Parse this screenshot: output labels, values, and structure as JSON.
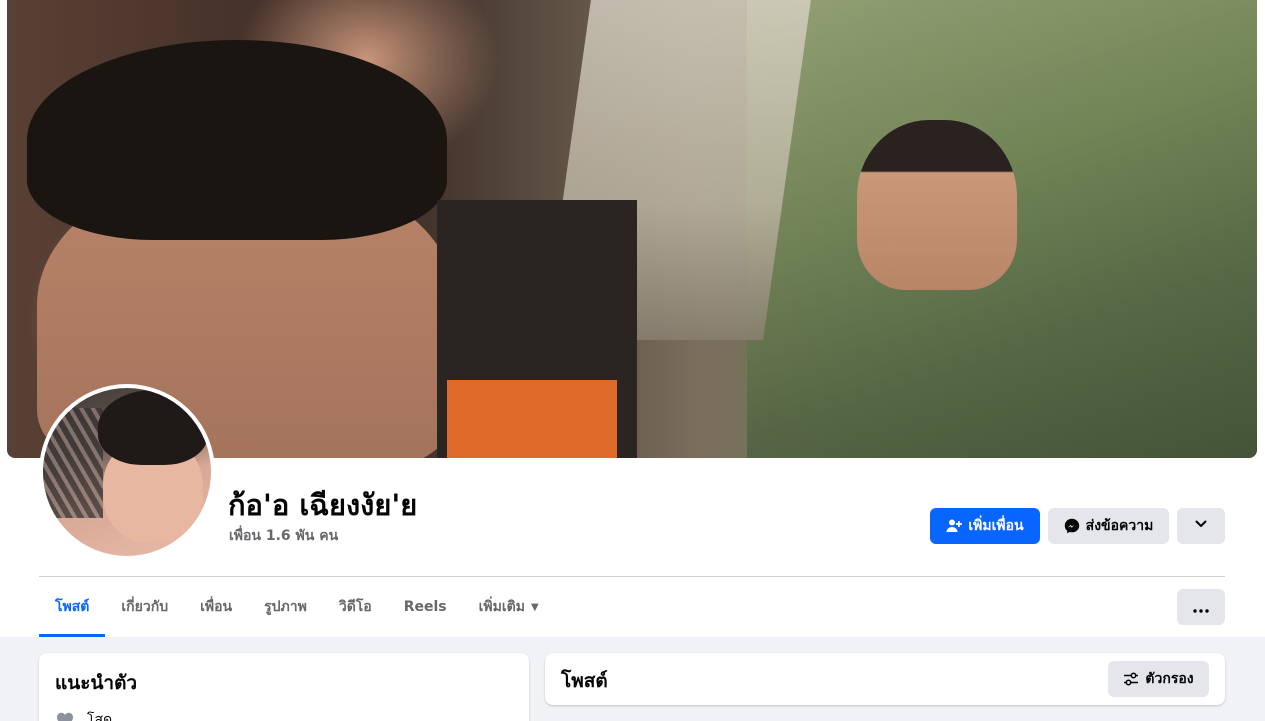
{
  "profile": {
    "name": "ก้อ'อ เฉียงงัย'ย",
    "friends_text": "เพื่อน 1.6 พัน คน"
  },
  "actions": {
    "add_friend": "เพิ่มเพื่อน",
    "message": "ส่งข้อความ"
  },
  "tabs": [
    {
      "label": "โพสต์",
      "active": true
    },
    {
      "label": "เกี่ยวกับ",
      "active": false
    },
    {
      "label": "เพื่อน",
      "active": false
    },
    {
      "label": "รูปภาพ",
      "active": false
    },
    {
      "label": "วิดีโอ",
      "active": false
    },
    {
      "label": "Reels",
      "active": false
    },
    {
      "label": "เพิ่มเติม",
      "active": false
    }
  ],
  "intro": {
    "title": "แนะนำตัว",
    "relationship": "โสด"
  },
  "posts": {
    "title": "โพสต์",
    "filter_label": "ตัวกรอง"
  },
  "colors": {
    "accent": "#0866ff",
    "secondary_button": "#e4e6eb",
    "page_background": "#f0f2f5",
    "muted_text": "#65676b"
  },
  "icons": [
    "add-friend-icon",
    "messenger-icon",
    "chevron-down-icon",
    "more-dots-icon",
    "heart-icon",
    "filter-icon",
    "caret-down-icon"
  ]
}
